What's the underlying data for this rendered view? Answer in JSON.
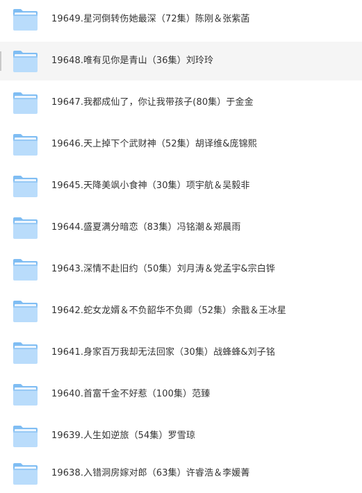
{
  "file_list": {
    "hover_index": 1,
    "items": [
      {
        "name": "19649.星河倒转伤她最深（72集）陈刚＆张紫菡",
        "icon": "folder-icon"
      },
      {
        "name": "19648.唯有见你是青山（36集）刘玲玲",
        "icon": "folder-icon"
      },
      {
        "name": "19647.我都成仙了，你让我带孩子(80集）于金金",
        "icon": "folder-icon"
      },
      {
        "name": "19646.天上掉下个武财神（52集）胡译维&庞锦熙",
        "icon": "folder-icon"
      },
      {
        "name": "19645.天降美飒小食神（30集）项宇航＆吴毅非",
        "icon": "folder-icon"
      },
      {
        "name": "19644.盛夏满分暗恋（83集）冯铭潮＆郑晨雨",
        "icon": "folder-icon"
      },
      {
        "name": "19643.深情不赴旧约（50集）刘月涛＆党孟宇&宗白铧",
        "icon": "folder-icon"
      },
      {
        "name": "19642.蛇女龙婿＆不负韶华不负卿（52集）余戬＆王冰星",
        "icon": "folder-icon"
      },
      {
        "name": "19641.身家百万我却无法回家（30集）战蜂蜂&刘子铭",
        "icon": "folder-icon"
      },
      {
        "name": "19640.首富千金不好惹（100集）范臻",
        "icon": "folder-icon"
      },
      {
        "name": "19639.人生如逆旅（54集）罗雪琼",
        "icon": "folder-icon"
      },
      {
        "name": "19638.入错洞房嫁对郎（63集）许睿浩＆李媛菁",
        "icon": "folder-icon"
      }
    ]
  },
  "colors": {
    "folder_light": "#b9dcfb",
    "folder_mid": "#7fbdf3",
    "folder_dark": "#5aa6ea",
    "text": "#333333",
    "hover_bg": "#f5f5f5"
  }
}
